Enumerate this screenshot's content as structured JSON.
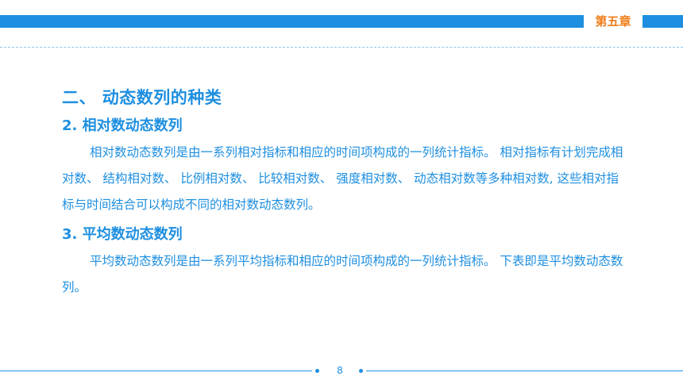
{
  "header": {
    "chapter": "第五章"
  },
  "content": {
    "section_title": "二、 动态数列的种类",
    "sub1_title": "2. 相对数动态数列",
    "sub1_paragraph": "相对数动态数列是由一系列相对指标和相应的时间项构成的一列统计指标。 相对指标有计划完成相对数、 结构相对数、 比例相对数、 比较相对数、 强度相对数、 动态相对数等多种相对数, 这些相对指标与时间结合可以构成不同的相对数动态数列。",
    "sub2_title": "3. 平均数动态数列",
    "sub2_paragraph": "平均数动态数列是由一系列平均指标和相应的时间项构成的一列统计指标。 下表即是平均数动态数列。"
  },
  "footer": {
    "page_number": "8"
  },
  "colors": {
    "primary_blue": "#1e8fe0",
    "accent_orange": "#ef7d19"
  }
}
